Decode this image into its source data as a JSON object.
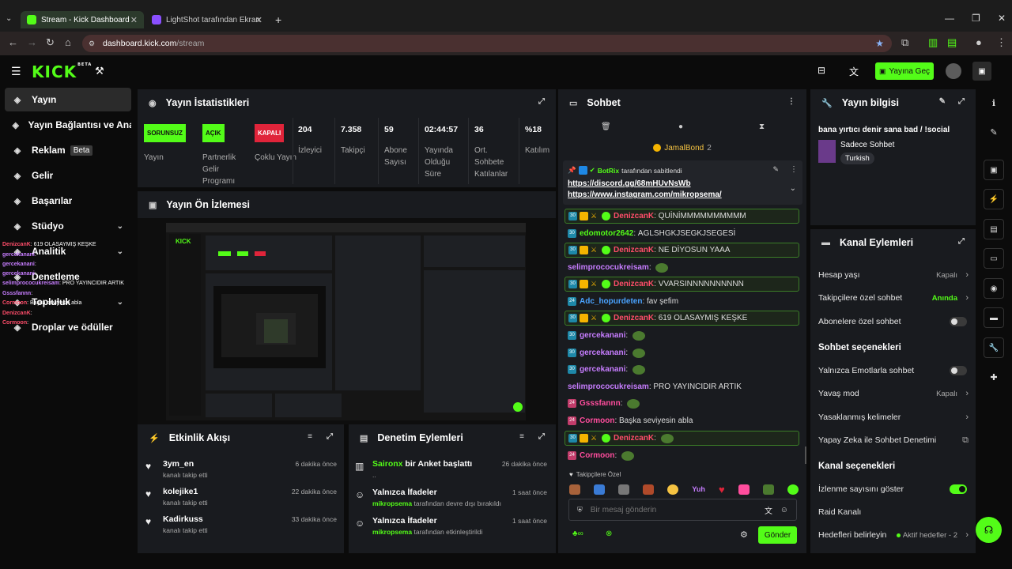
{
  "browser": {
    "tabs": [
      {
        "label": "Stream - Kick Dashboard"
      },
      {
        "label": "LightShot tarafından Ekran Görü..."
      }
    ],
    "url_host": "dashboard.kick.com",
    "url_path": "/stream"
  },
  "header": {
    "logo": "KICK",
    "logo_sup": "BETA",
    "go_live": "Yayına Geç"
  },
  "sidebar": {
    "items": [
      {
        "label": "Yayın",
        "icon": "broadcast-icon"
      },
      {
        "label": "Yayın Bağlantısı ve Anahtarı",
        "icon": "link-icon"
      },
      {
        "label": "Reklam",
        "icon": "ad-icon",
        "badge": "Beta"
      },
      {
        "label": "Gelir",
        "icon": "revenue-icon"
      },
      {
        "label": "Başarılar",
        "icon": "trophy-icon"
      },
      {
        "label": "Stüdyo",
        "icon": "studio-icon"
      },
      {
        "label": "Analitik",
        "icon": "analytics-icon"
      },
      {
        "label": "Denetleme",
        "icon": "moderation-icon"
      },
      {
        "label": "Topluluk",
        "icon": "community-icon"
      },
      {
        "label": "Droplar ve ödüller",
        "icon": "drops-icon"
      }
    ],
    "overlay": [
      {
        "user": "DenizcanK",
        "text": ": 619 OLASAYMIŞ KEŞKE"
      },
      {
        "user": "gercekanani",
        "text": ":"
      },
      {
        "user": "gercekanani",
        "text": ":"
      },
      {
        "user": "gercekanani",
        "text": ":"
      },
      {
        "user": "selimprococukreisam",
        "text": ": PRO YAYINCIDIR ARTIK"
      },
      {
        "user": "Gsssfannn",
        "text": ":"
      },
      {
        "user": "Cormoon",
        "text": ": Başka seviyesin abla"
      },
      {
        "user": "DenizcanK",
        "text": ":"
      },
      {
        "user": "Cormoon",
        "text": ":"
      }
    ]
  },
  "stats": {
    "title": "Yayın İstatistikleri",
    "badges": [
      {
        "badge": "SORUNSUZ",
        "label": "Yayın",
        "color": "#53fc18",
        "fg": "#111"
      },
      {
        "badge": "AÇIK",
        "label": "Partnerlik Gelir Programı",
        "color": "#53fc18",
        "fg": "#111"
      },
      {
        "badge": "KAPALI",
        "label": "Çoklu Yayın",
        "color": "#e0243a",
        "fg": "#fff"
      }
    ],
    "metrics": [
      {
        "value": "204",
        "label": "İzleyici"
      },
      {
        "value": "7.358",
        "label": "Takipçi"
      },
      {
        "value": "59",
        "label": "Abone Sayısı"
      },
      {
        "value": "02:44:57",
        "label": "Yayında Olduğu Süre"
      },
      {
        "value": "36",
        "label": "Ort. Sohbete Katılanlar"
      },
      {
        "value": "%18",
        "label": "Katılım"
      }
    ]
  },
  "preview": {
    "title": "Yayın Ön İzlemesi"
  },
  "activity": {
    "title": "Etkinlik Akışı",
    "items": [
      {
        "name": "3ym_en",
        "sub": "kanalı takip etti",
        "time": "6 dakika önce"
      },
      {
        "name": "kolejike1",
        "sub": "kanalı takip etti",
        "time": "22 dakika önce"
      },
      {
        "name": "Kadirkuss",
        "sub": "kanalı takip etti",
        "time": "33 dakika önce"
      }
    ]
  },
  "modlog": {
    "title": "Denetim Eylemleri",
    "items": [
      {
        "user": "Saironx",
        "action": " bir Anket başlattı",
        "sub": "..",
        "time": "26 dakika önce"
      },
      {
        "title": "Yalnızca İfadeler",
        "user": "mikropsema",
        "sub": " tarafından devre dışı bırakıldı",
        "time": "1 saat önce"
      },
      {
        "title": "Yalnızca İfadeler",
        "user": "mikropsema",
        "sub": " tarafından etkinleştirildi",
        "time": "1 saat önce"
      }
    ]
  },
  "chat": {
    "title": "Sohbet",
    "top_gifter": "JamalBond",
    "top_gifter_count": "2",
    "pinned_by": "BotRix",
    "pinned_suffix": "tarafından sabitlendi",
    "pinned_links": [
      "https://discord.gg/68mHUvNsWb",
      "https://www.instagram.com/mikropsema/"
    ],
    "messages": [
      {
        "user": "DenizcanK",
        "color": "#ff4d6a",
        "text": "QUİNİMMMMMMMMMM",
        "hl": true,
        "sub": "30",
        "badges": true
      },
      {
        "user": "edomotor2642",
        "color": "#53fc18",
        "text": "AGLSHGKJSEGKJSEGESİ",
        "hl": false,
        "sub": "30"
      },
      {
        "user": "DenizcanK",
        "color": "#ff4d6a",
        "text": "NE DİYOSUN YAAA",
        "hl": true,
        "sub": "30",
        "badges": true
      },
      {
        "user": "selimprococukreisam",
        "color": "#c77dff",
        "text": "",
        "hl": false,
        "emote": true
      },
      {
        "user": "DenizcanK",
        "color": "#ff4d6a",
        "text": "VVARSINNNNNNNNNN",
        "hl": true,
        "sub": "30",
        "badges": true
      },
      {
        "user": "Adc_hopurdeten",
        "color": "#4aa3ff",
        "text": "fav şefim",
        "hl": false,
        "sub": "24"
      },
      {
        "user": "DenizcanK",
        "color": "#ff4d6a",
        "text": "619 OLASAYMIŞ KEŞKE",
        "hl": true,
        "sub": "30",
        "badges": true
      },
      {
        "user": "gercekanani",
        "color": "#c77dff",
        "text": "",
        "hl": false,
        "sub": "30",
        "emote": true
      },
      {
        "user": "gercekanani",
        "color": "#c77dff",
        "text": "",
        "hl": false,
        "sub": "30",
        "emote": true
      },
      {
        "user": "gercekanani",
        "color": "#c77dff",
        "text": "",
        "hl": false,
        "sub": "30",
        "emote": true
      },
      {
        "user": "selimprococukreisam",
        "color": "#c77dff",
        "text": "PRO YAYINCIDIR ARTIK",
        "hl": false
      },
      {
        "user": "Gsssfannn",
        "color": "#ff4d9d",
        "text": "",
        "hl": false,
        "sub": "24",
        "pink": true,
        "emote": true
      },
      {
        "user": "Cormoon",
        "color": "#ff4d9d",
        "text": "Başka seviyesin abla",
        "hl": false,
        "sub": "24",
        "pink": true
      },
      {
        "user": "DenizcanK",
        "color": "#ff4d6a",
        "text": "",
        "hl": true,
        "sub": "30",
        "badges": true,
        "emote": true
      },
      {
        "user": "Cormoon",
        "color": "#ff4d9d",
        "text": "",
        "hl": false,
        "sub": "24",
        "pink": true,
        "emote": true
      }
    ],
    "followers_only": "Takipçilere Özel",
    "emote_text": "Yuh",
    "input_placeholder": "Bir mesaj gönderin",
    "send": "Gönder"
  },
  "stream_info": {
    "title": "Yayın bilgisi",
    "stream_title": "bana yırtıcı denir sana bad / !social",
    "category": "Sadece Sohbet",
    "tag": "Turkish"
  },
  "channel_actions": {
    "title": "Kanal Eylemleri",
    "rows1": [
      {
        "label": "Hesap yaşı",
        "value": "Kapalı",
        "kind": "chev"
      },
      {
        "label": "Takipçilere özel sohbet",
        "value": "Anında",
        "kind": "chev",
        "green": true
      },
      {
        "label": "Abonelere özel sohbet",
        "kind": "toggle",
        "on": false
      }
    ],
    "chat_options_title": "Sohbet seçenekleri",
    "rows2": [
      {
        "label": "Yalnızca Emotlarla sohbet",
        "kind": "toggle",
        "on": false
      },
      {
        "label": "Yavaş mod",
        "value": "Kapalı",
        "kind": "chev"
      },
      {
        "label": "Yasaklanmış kelimeler",
        "kind": "chev"
      },
      {
        "label": "Yapay Zeka ile Sohbet Denetimi",
        "kind": "ext"
      }
    ],
    "channel_options_title": "Kanal seçenekleri",
    "rows3": [
      {
        "label": "İzlenme sayısını göster",
        "kind": "toggle",
        "on": true
      },
      {
        "label": "Raid Kanalı",
        "kind": "none"
      },
      {
        "label": "Hedefleri belirleyin",
        "value": "Aktif hedefler - 2",
        "kind": "chev",
        "dot": true
      }
    ]
  },
  "colors": {
    "accent": "#53fc18",
    "panel": "#191b1f",
    "danger": "#e0243a"
  }
}
